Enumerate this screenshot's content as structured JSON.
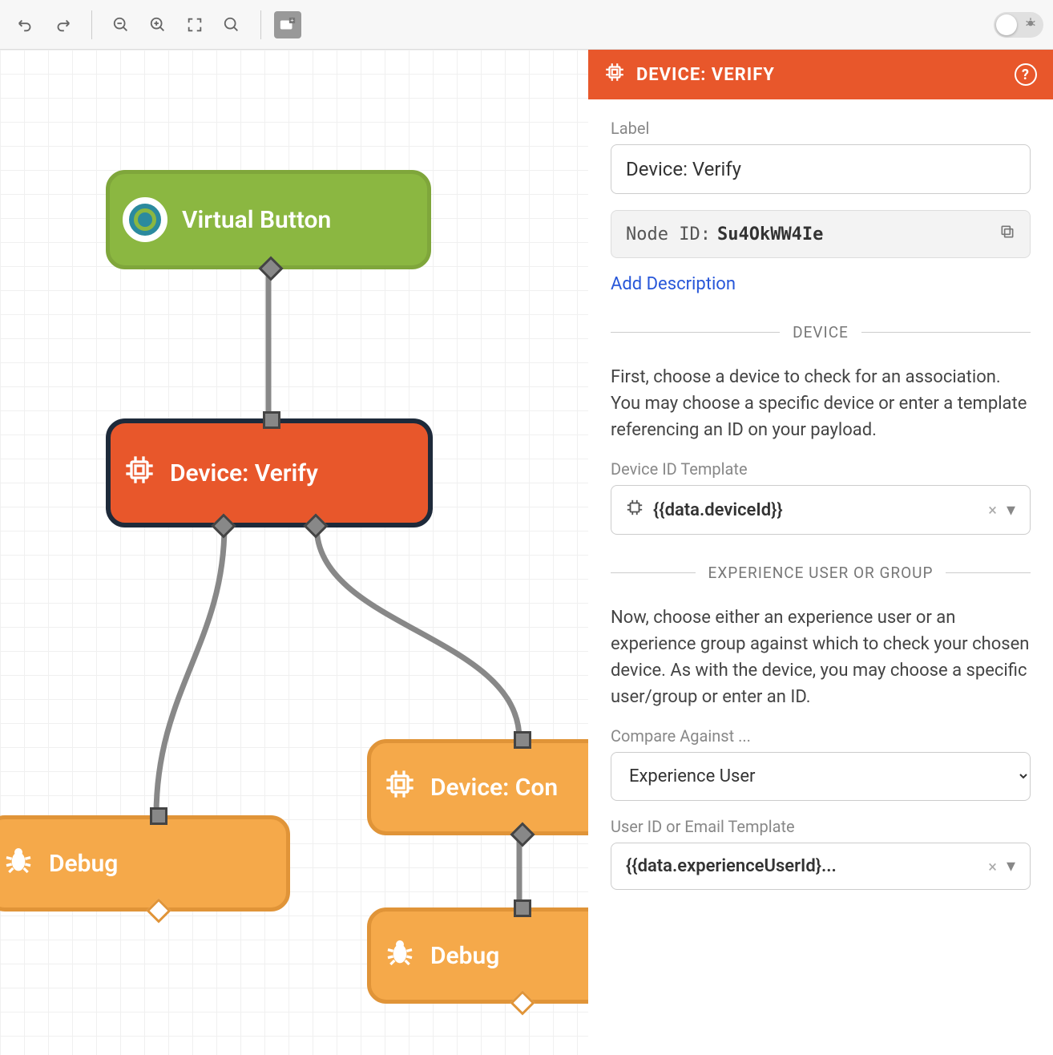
{
  "toolbar": {
    "undo": "undo",
    "redo": "redo"
  },
  "nodes": {
    "virtual_button": "Virtual Button",
    "device_verify": "Device: Verify",
    "debug1": "Debug",
    "device_con": "Device: Con",
    "debug2": "Debug"
  },
  "panel": {
    "header": "DEVICE: VERIFY",
    "label_field": "Label",
    "label_value": "Device: Verify",
    "node_id_label": "Node ID:",
    "node_id_value": "Su4OkWW4Ie",
    "add_description": "Add Description",
    "device_section": "DEVICE",
    "device_help": "First, choose a device to check for an association. You may choose a specific device or enter a template referencing an ID on your payload.",
    "device_id_label": "Device ID Template",
    "device_id_value": "{{data.deviceId}}",
    "exp_section": "EXPERIENCE USER OR GROUP",
    "exp_help": "Now, choose either an experience user or an experience group against which to check your chosen device. As with the device, you may choose a specific user/group or enter an ID.",
    "compare_label": "Compare Against ...",
    "compare_value": "Experience User",
    "user_id_label": "User ID or Email Template",
    "user_id_value": "{{data.experienceUserId}..."
  }
}
